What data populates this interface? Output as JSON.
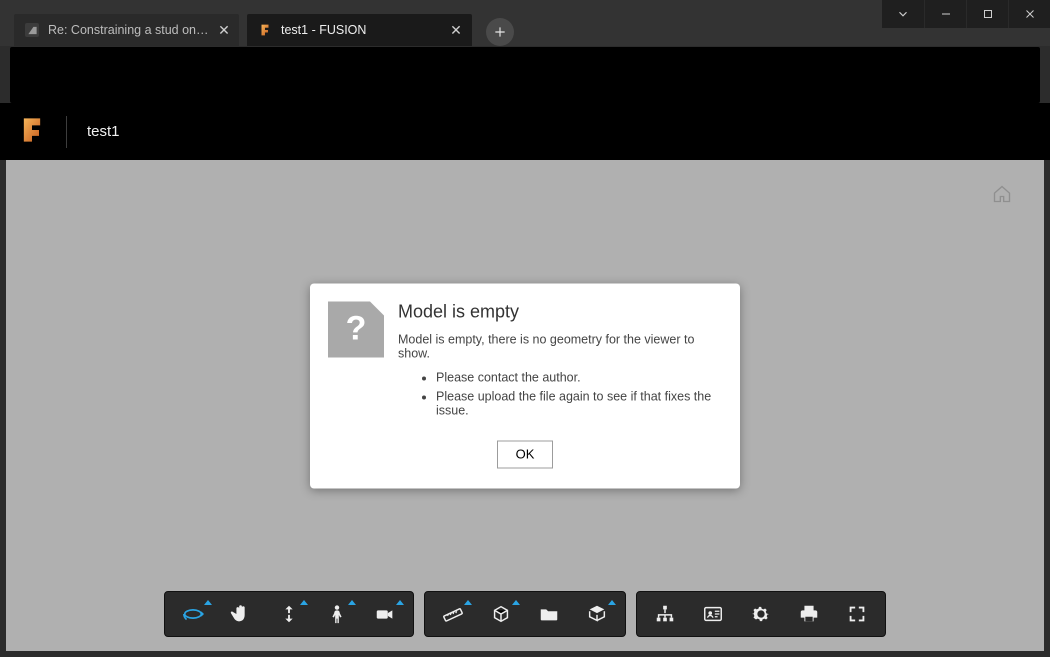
{
  "tabs": [
    {
      "label": "Re: Constraining a stud on a wall",
      "active": false,
      "favicon": "autodesk"
    },
    {
      "label": "test1 - FUSION",
      "active": true,
      "favicon": "fusion"
    }
  ],
  "window_controls": {
    "dropdown": "⌄",
    "minimize": "—",
    "maximize": "☐",
    "close": "✕"
  },
  "document": {
    "name": "test1"
  },
  "viewer": {
    "home_icon": "home-icon"
  },
  "dialog": {
    "title": "Model is empty",
    "message": "Model is empty, there is no geometry for the viewer to show.",
    "bullets": [
      "Please contact the author.",
      "Please upload the file again to see if that fixes the issue."
    ],
    "ok_label": "OK"
  },
  "toolbar_groups": [
    {
      "buttons": [
        {
          "name": "orbit-button",
          "icon": "orbit",
          "active": true,
          "badge": true
        },
        {
          "name": "pan-button",
          "icon": "hand"
        },
        {
          "name": "zoom-button",
          "icon": "zoom-vert",
          "badge": true
        },
        {
          "name": "walk-button",
          "icon": "person",
          "badge": true
        },
        {
          "name": "camera-button",
          "icon": "camera",
          "badge": true
        }
      ]
    },
    {
      "buttons": [
        {
          "name": "measure-button",
          "icon": "ruler",
          "badge": true
        },
        {
          "name": "section-button",
          "icon": "cube-slice",
          "badge": true
        },
        {
          "name": "explode-button",
          "icon": "folder"
        },
        {
          "name": "model-browser-button",
          "icon": "cube-open",
          "badge": true
        }
      ]
    },
    {
      "buttons": [
        {
          "name": "tree-button",
          "icon": "tree"
        },
        {
          "name": "properties-button",
          "icon": "id-card"
        },
        {
          "name": "settings-button",
          "icon": "gear"
        },
        {
          "name": "print-button",
          "icon": "printer"
        },
        {
          "name": "fullscreen-button",
          "icon": "expand"
        }
      ]
    }
  ]
}
